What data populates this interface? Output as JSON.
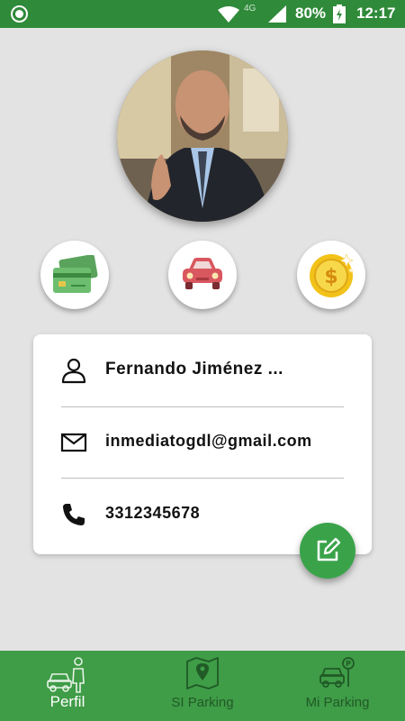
{
  "status_bar": {
    "network_type": "4G",
    "battery": "80%",
    "time": "12:17",
    "icons": [
      "app-notification-icon",
      "wifi-icon",
      "signal-icon",
      "battery-icon"
    ]
  },
  "profile": {
    "avatar_icon": "profile-photo",
    "actions": [
      {
        "name": "payment-cards",
        "icon": "credit-cards-icon"
      },
      {
        "name": "vehicle",
        "icon": "car-icon"
      },
      {
        "name": "credits",
        "icon": "coin-icon"
      }
    ],
    "name": "Fernando Jiménez ...",
    "email": "inmediatogdl@gmail.com",
    "phone": "3312345678",
    "edit_icon": "edit-icon"
  },
  "bottom_nav": {
    "items": [
      {
        "label": "Perfil",
        "icon": "valet-car-icon",
        "active": true
      },
      {
        "label": "SI Parking",
        "icon": "map-pin-icon",
        "active": false
      },
      {
        "label": "Mi Parking",
        "icon": "parking-car-icon",
        "active": false
      }
    ]
  },
  "colors": {
    "primary": "#3f9c47",
    "status_bar": "#2f8a39",
    "fab": "#3aa34a",
    "background": "#e3e3e3",
    "car": "#d9575f",
    "coin": "#f2c219"
  }
}
